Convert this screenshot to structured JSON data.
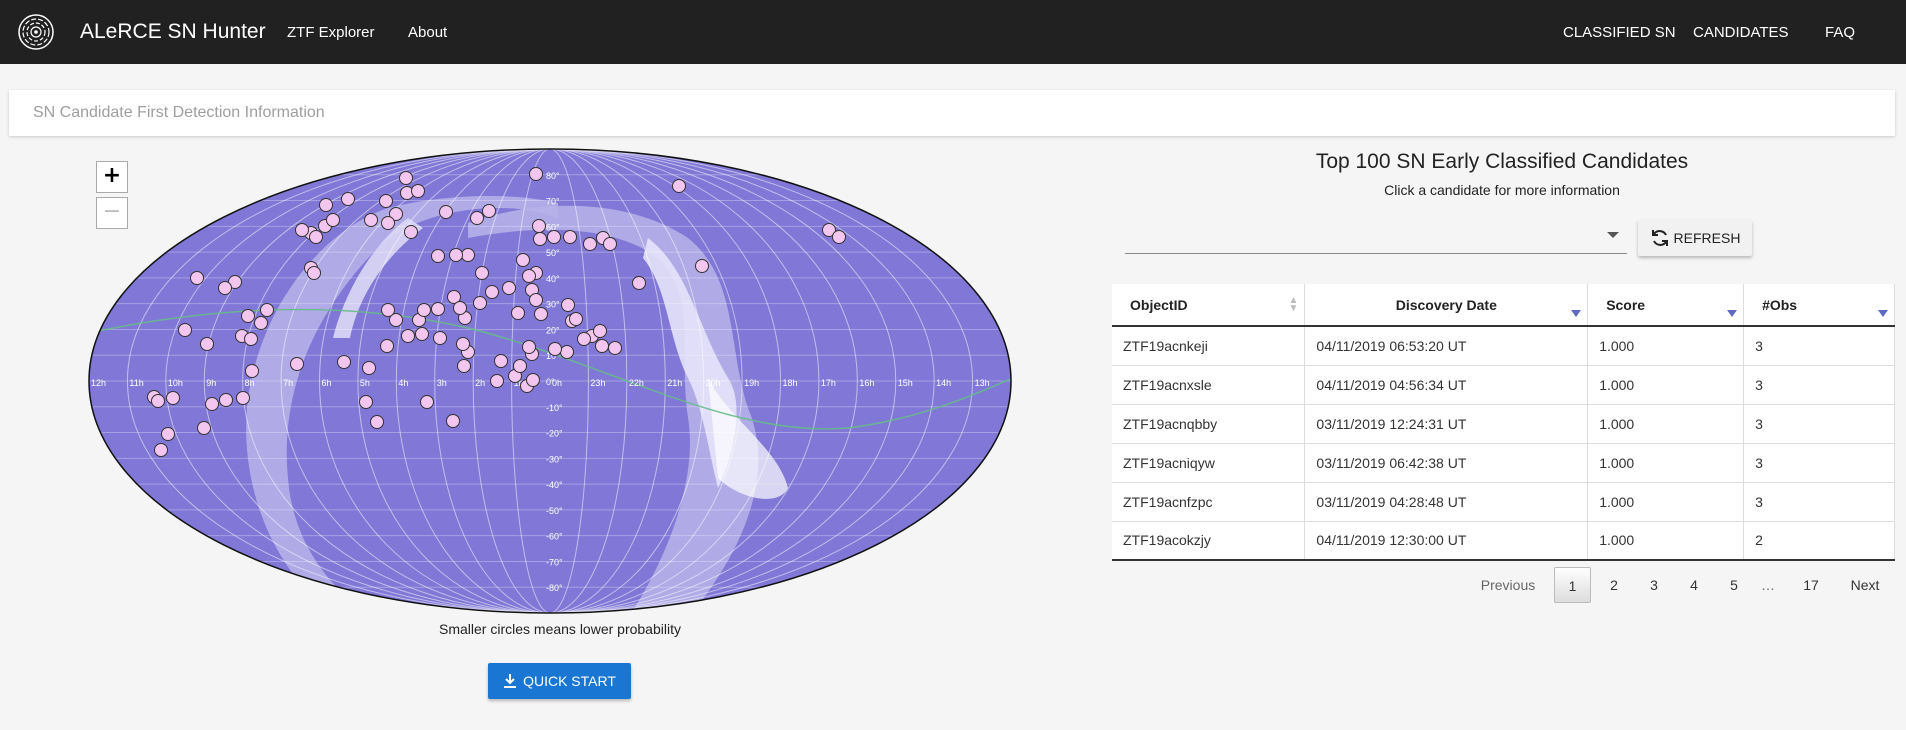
{
  "nav": {
    "brand": "ALeRCE SN Hunter",
    "links": [
      "ZTF Explorer",
      "About"
    ],
    "right_links": [
      "CLASSIFIED SN",
      "CANDIDATES",
      "FAQ"
    ]
  },
  "panel": {
    "title": "SN Candidate First Detection Information"
  },
  "map": {
    "zoom_in": "+",
    "zoom_out": "−",
    "dec_labels": [
      "80°",
      "70°",
      "60°",
      "50°",
      "40°",
      "30°",
      "20°",
      "10°",
      "0°",
      "-10°",
      "-20°",
      "-30°",
      "-40°",
      "-50°",
      "-60°",
      "-70°",
      "-80°"
    ],
    "ra_labels": [
      "12h",
      "11h",
      "10h",
      "9h",
      "8h",
      "7h",
      "6h",
      "5h",
      "4h",
      "3h",
      "2h",
      "1h",
      "0h",
      "23h",
      "22h",
      "21h",
      "20h",
      "19h",
      "18h",
      "17h",
      "16h",
      "15h",
      "14h",
      "13h"
    ],
    "colors": {
      "sky": "#8077d6",
      "milkyway": "#b9b3ea",
      "point": "#f2c6ef",
      "ecliptic": "#66bb8a"
    }
  },
  "caption": "Smaller circles means lower probability",
  "quick_start": "QUICK START",
  "right": {
    "title": "Top 100 SN Early Classified Candidates",
    "subtitle": "Click a candidate for more information",
    "refresh": "REFRESH"
  },
  "table": {
    "headers": [
      "ObjectID",
      "Discovery Date",
      "Score",
      "#Obs"
    ],
    "rows": [
      [
        "ZTF19acnkeji",
        "04/11/2019 06:53:20 UT",
        "1.000",
        "3"
      ],
      [
        "ZTF19acnxsle",
        "04/11/2019 04:56:34 UT",
        "1.000",
        "3"
      ],
      [
        "ZTF19acnqbby",
        "03/11/2019 12:24:31 UT",
        "1.000",
        "3"
      ],
      [
        "ZTF19acniqyw",
        "03/11/2019 06:42:38 UT",
        "1.000",
        "3"
      ],
      [
        "ZTF19acnfzpc",
        "03/11/2019 04:28:48 UT",
        "1.000",
        "3"
      ],
      [
        "ZTF19acokzjy",
        "04/11/2019 12:30:00 UT",
        "1.000",
        "2"
      ]
    ]
  },
  "pagination": {
    "previous": "Previous",
    "pages": [
      "1",
      "2",
      "3",
      "4",
      "5",
      "…",
      "17"
    ],
    "next": "Next",
    "current": "1"
  }
}
